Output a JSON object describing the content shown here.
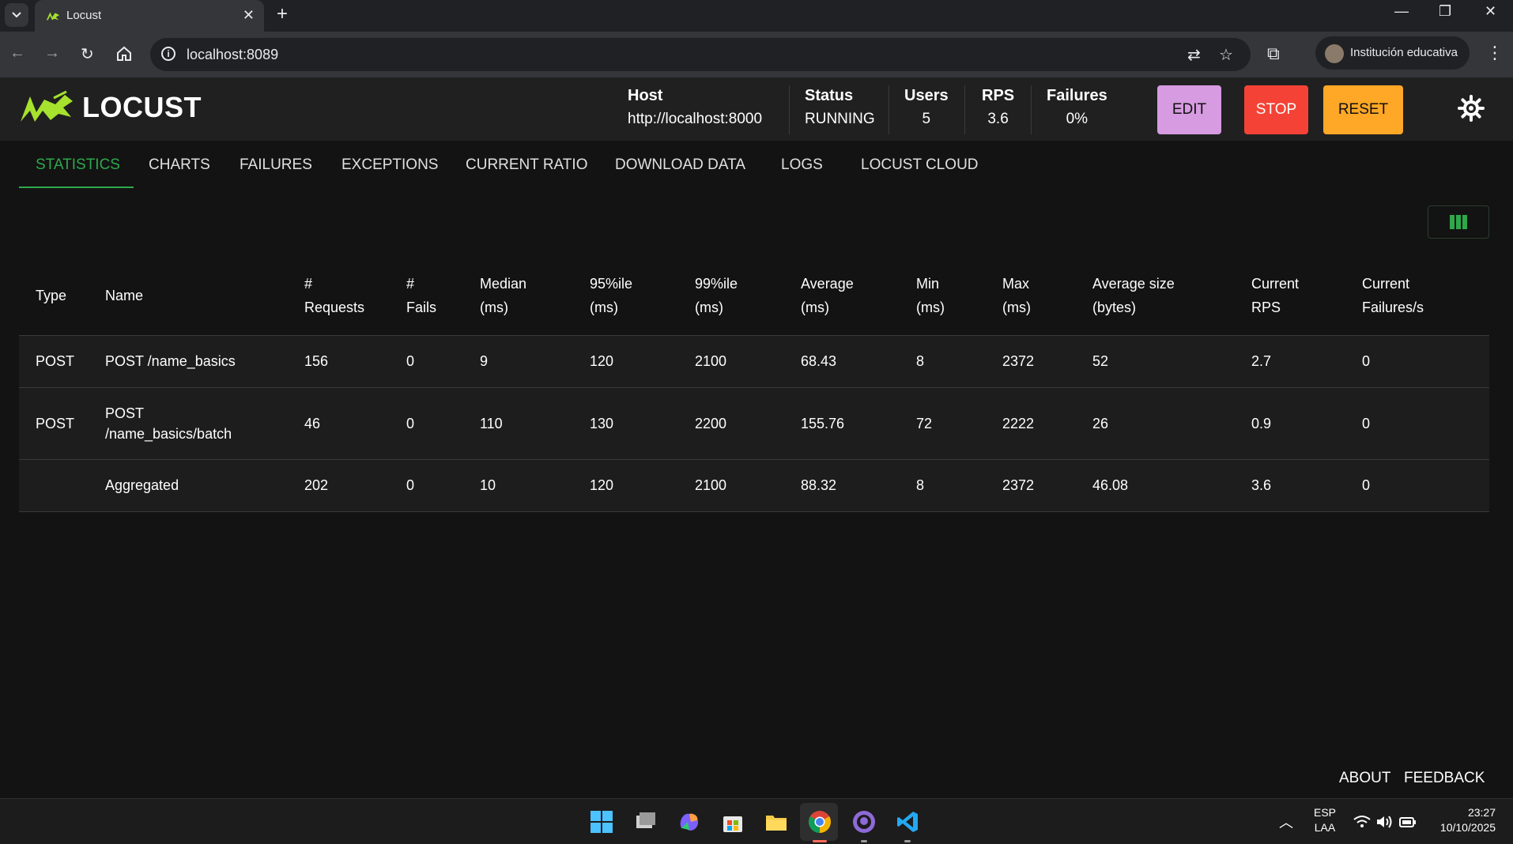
{
  "browser": {
    "tab_title": "Locust",
    "url": "localhost:8089",
    "profile_name": "Institución educativa"
  },
  "header": {
    "logo_text": "LOCUST",
    "host_label": "Host",
    "host_value": "http://localhost:8000",
    "status_label": "Status",
    "status_value": "RUNNING",
    "users_label": "Users",
    "users_value": "5",
    "rps_label": "RPS",
    "rps_value": "3.6",
    "failures_label": "Failures",
    "failures_value": "0%",
    "edit_label": "EDIT",
    "stop_label": "STOP",
    "reset_label": "RESET",
    "colors": {
      "edit": "#d69be0",
      "stop": "#f44336",
      "reset": "#ffa726",
      "accent": "#2ea84b"
    }
  },
  "tabs": [
    "STATISTICS",
    "CHARTS",
    "FAILURES",
    "EXCEPTIONS",
    "CURRENT RATIO",
    "DOWNLOAD DATA",
    "LOGS",
    "LOCUST CLOUD"
  ],
  "table": {
    "headers": [
      [
        "Type"
      ],
      [
        "Name"
      ],
      [
        "#",
        "Requests"
      ],
      [
        "#",
        "Fails"
      ],
      [
        "Median",
        "(ms)"
      ],
      [
        "95%ile",
        "(ms)"
      ],
      [
        "99%ile",
        "(ms)"
      ],
      [
        "Average",
        "(ms)"
      ],
      [
        "Min",
        "(ms)"
      ],
      [
        "Max",
        "(ms)"
      ],
      [
        "Average size",
        "(bytes)"
      ],
      [
        "Current",
        "RPS"
      ],
      [
        "Current",
        "Failures/s"
      ]
    ],
    "rows": [
      [
        "POST",
        "POST /name_basics",
        "156",
        "0",
        "9",
        "120",
        "2100",
        "68.43",
        "8",
        "2372",
        "52",
        "2.7",
        "0"
      ],
      [
        "POST",
        "POST\n/name_basics/batch",
        "46",
        "0",
        "110",
        "130",
        "2200",
        "155.76",
        "72",
        "2222",
        "26",
        "0.9",
        "0"
      ],
      [
        "",
        "Aggregated",
        "202",
        "0",
        "10",
        "120",
        "2100",
        "88.32",
        "8",
        "2372",
        "46.08",
        "3.6",
        "0"
      ]
    ]
  },
  "footer": {
    "about": "ABOUT",
    "feedback": "FEEDBACK"
  },
  "taskbar": {
    "lang_line1": "ESP",
    "lang_line2": "LAA",
    "time": "23:27",
    "date": "10/10/2025"
  }
}
